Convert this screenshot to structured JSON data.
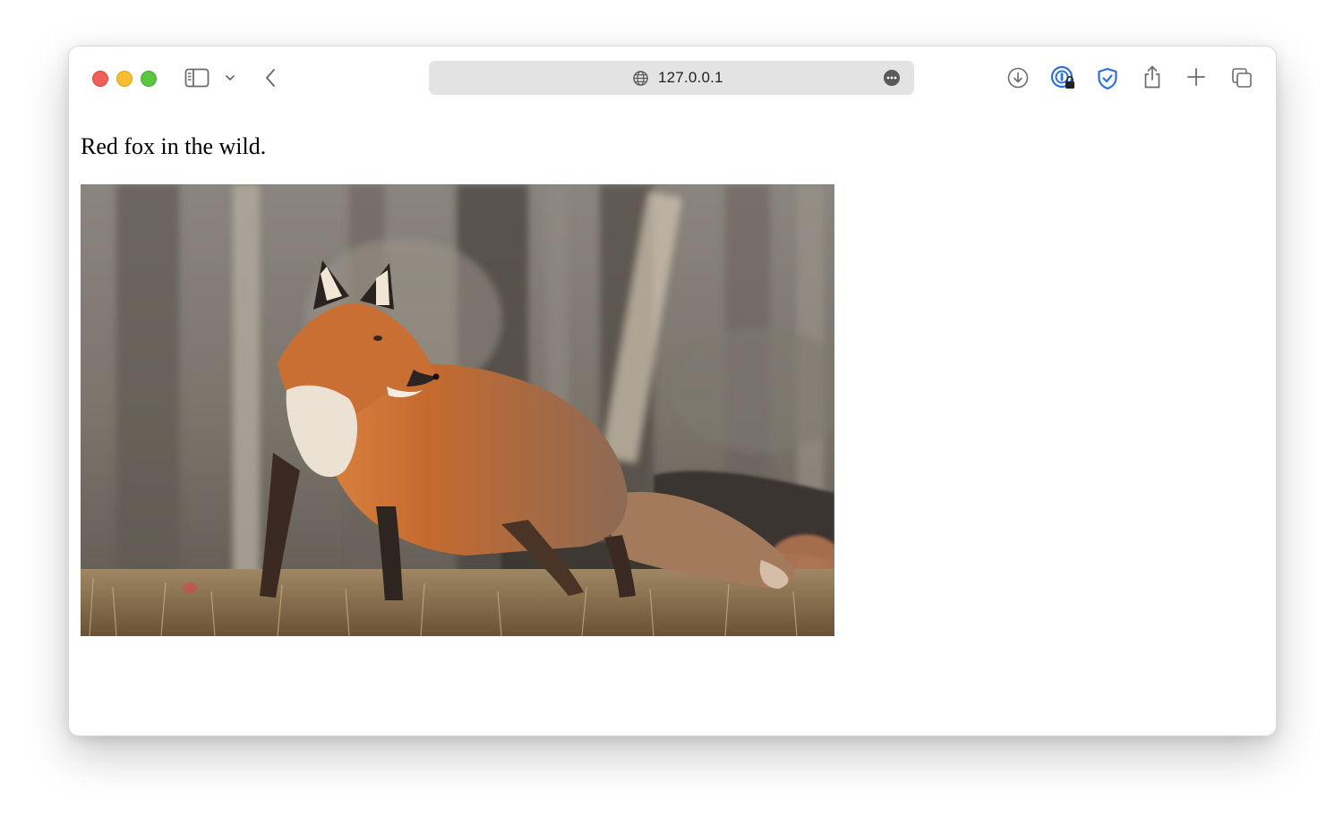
{
  "browser": {
    "url": "127.0.0.1",
    "icons": {
      "sidebar": "sidebar-icon",
      "sidebar_menu": "chevron-down-icon",
      "back": "chevron-left-icon",
      "site": "globe-icon",
      "page_menu": "ellipsis-circle-icon",
      "downloads": "download-icon",
      "password_manager": "password-lock-icon",
      "extension": "shield-check-icon",
      "share": "share-icon",
      "new_tab": "plus-icon",
      "tab_overview": "tabs-icon"
    },
    "colors": {
      "close": "#ee5f57",
      "minimize": "#f5bd2f",
      "maximize": "#5ac53f",
      "accent": "#2f6fd8"
    }
  },
  "page": {
    "caption": "Red fox in the wild."
  }
}
